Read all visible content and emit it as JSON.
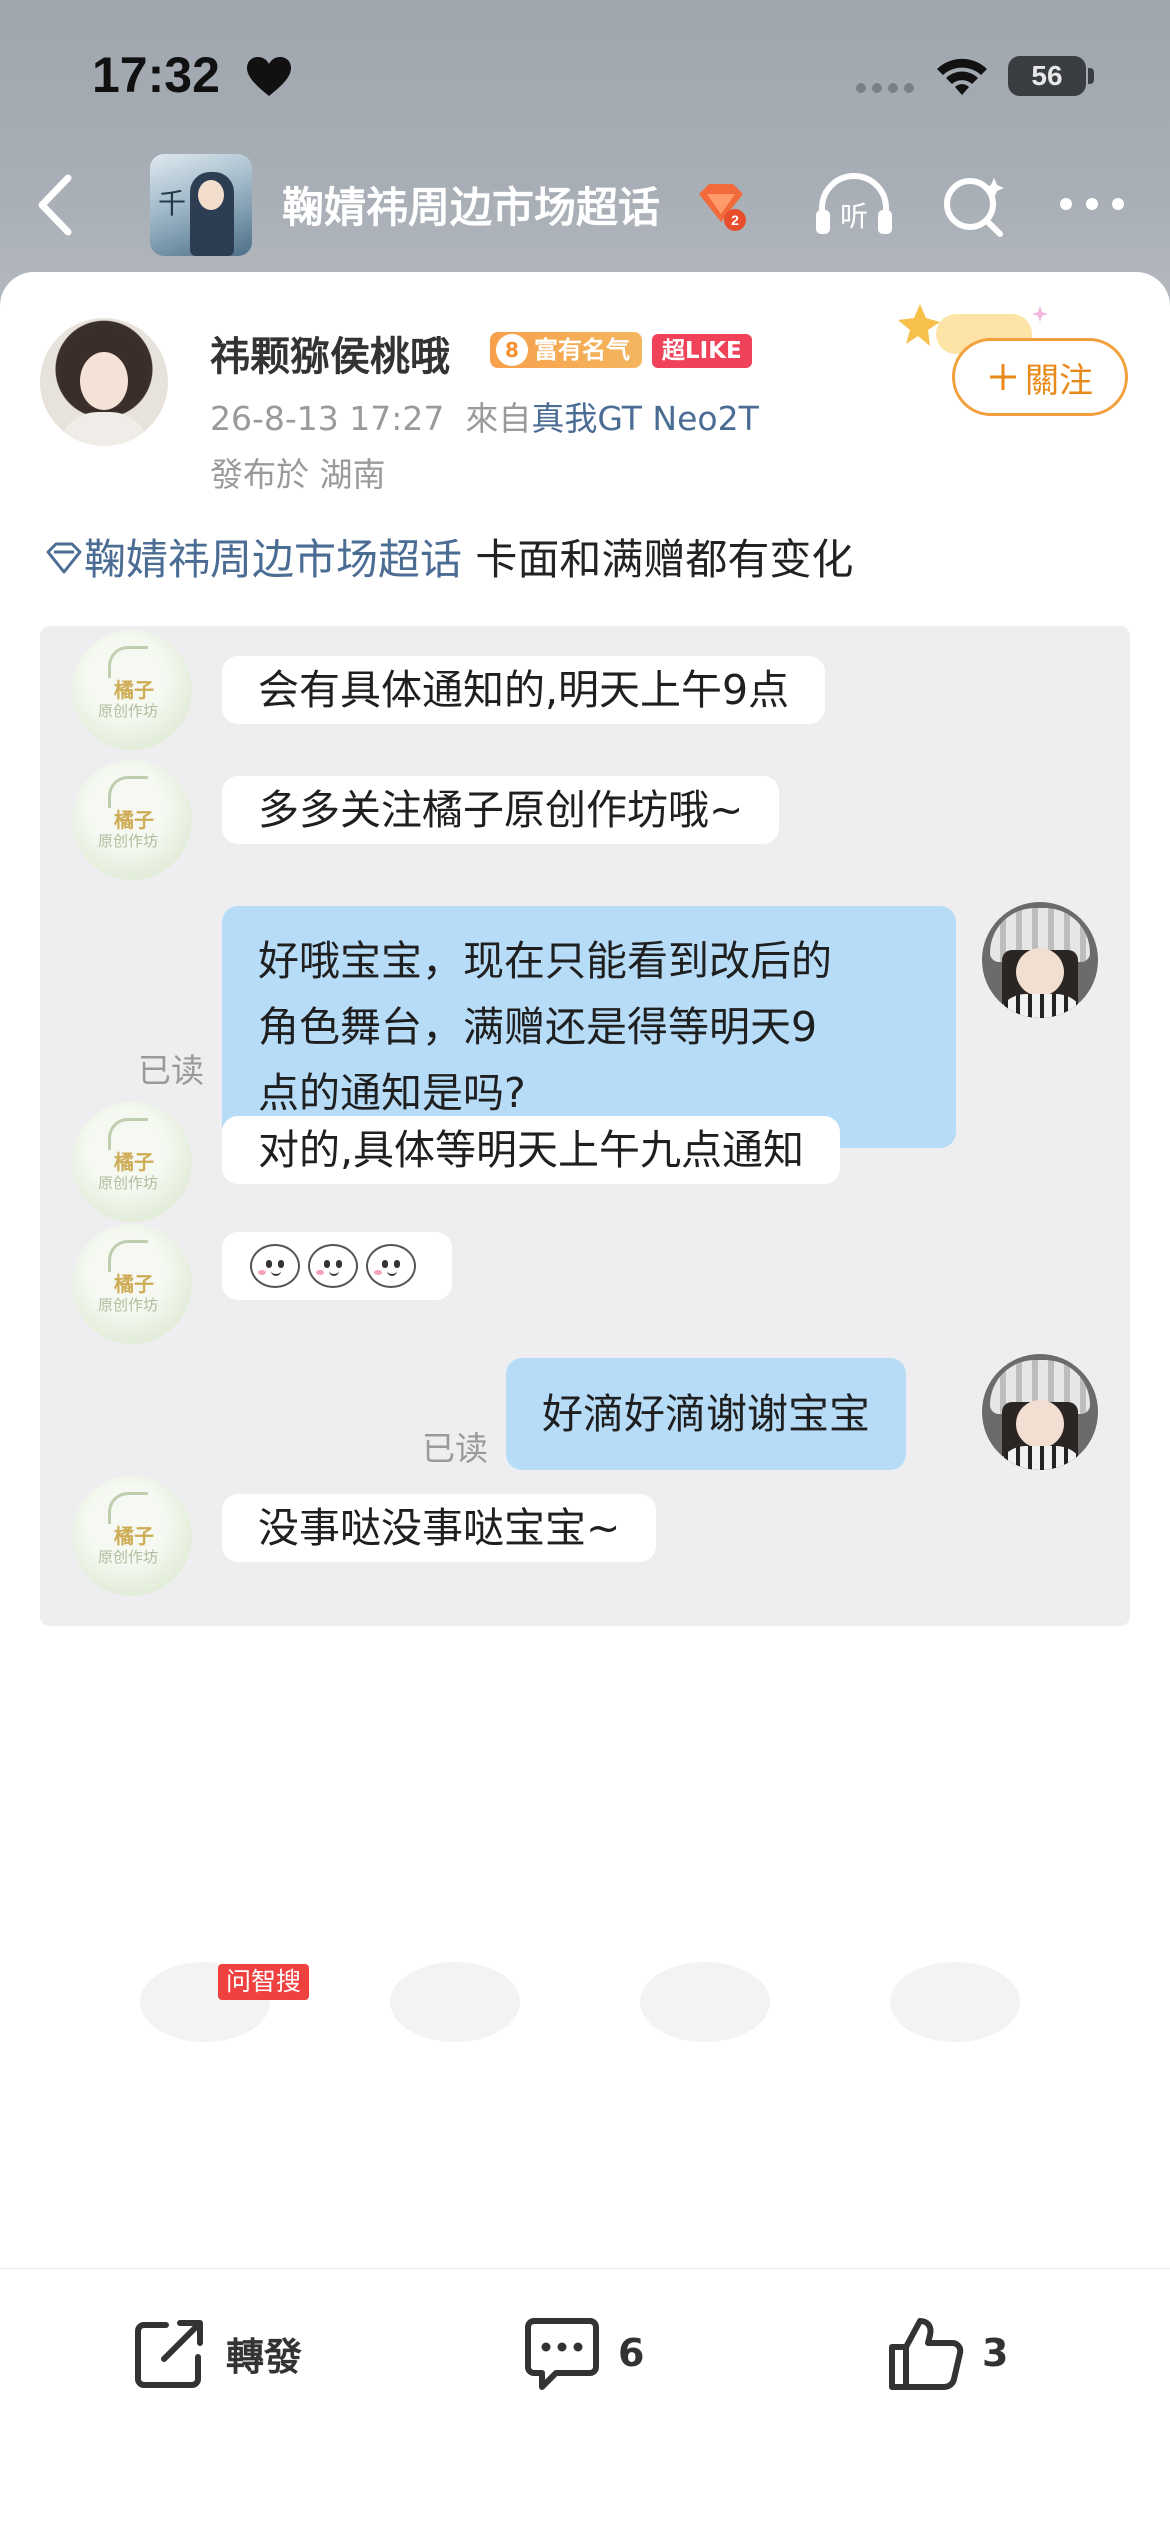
{
  "status": {
    "time": "17:32",
    "battery": "56"
  },
  "nav": {
    "title": "鞠婧祎周边市场超话",
    "thumb_text": "千"
  },
  "post": {
    "username": "祎颗猕侯桃哦",
    "fame_badge": {
      "level": "8",
      "label": "富有名气"
    },
    "superlike_badge": "超LIKE",
    "date": "26-8-13 17:27",
    "from_label": "來自",
    "device": "真我GT Neo2T",
    "location": "發布於 湖南",
    "follow_label": "關注",
    "topic_link": "鞠婧祎周边市场超话",
    "text": "卡面和满赠都有变化"
  },
  "chat": {
    "shop_avatar_text": {
      "name": "橘子",
      "sub": "原创作坊"
    },
    "messages": [
      {
        "side": "left",
        "text": "会有具体通知的,明天上午9点"
      },
      {
        "side": "left",
        "text": "多多关注橘子原创作坊哦~"
      },
      {
        "side": "right",
        "lines": [
          "好哦宝宝，现在只能看到改后的",
          "角色舞台，满赠还是得等明天9",
          "点的通知是吗?"
        ],
        "read": "已读"
      },
      {
        "side": "left",
        "text": "对的,具体等明天上午九点通知"
      },
      {
        "side": "left",
        "emoji": "smiling-face-emoji x3"
      },
      {
        "side": "right",
        "text": "好滴好滴谢谢宝宝",
        "read": "已读"
      },
      {
        "side": "left",
        "text": "没事哒没事哒宝宝~"
      }
    ]
  },
  "ask_tag": "问智搜",
  "actions": {
    "repost_label": "轉發",
    "comment_count": "6",
    "like_count": "3"
  },
  "colors": {
    "link": "#4b6c93",
    "follow": "#f2a03b",
    "bubble_right": "#b7dcf8",
    "superlike": "#f0435a"
  }
}
